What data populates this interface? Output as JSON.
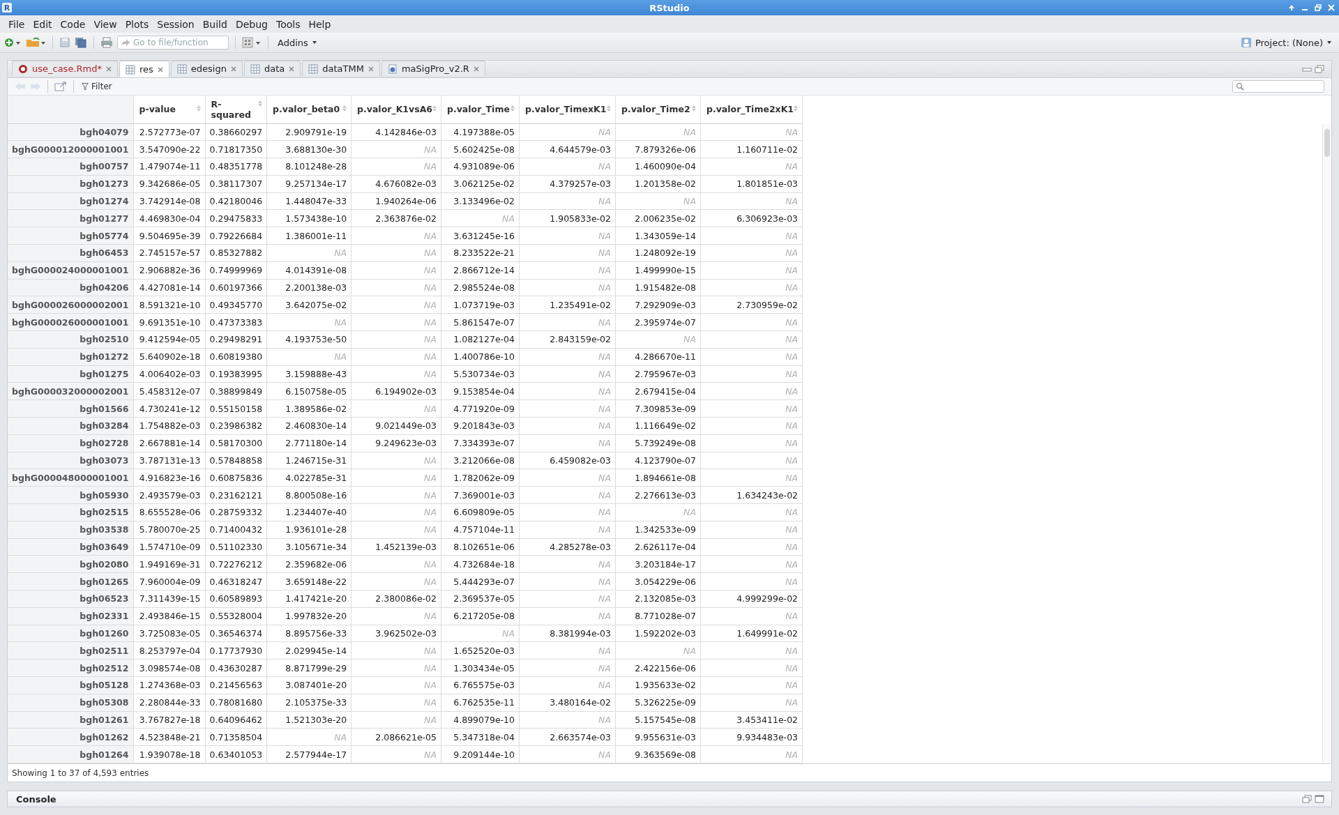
{
  "window": {
    "title": "RStudio",
    "icon_letter": "R"
  },
  "menu": [
    "File",
    "Edit",
    "Code",
    "View",
    "Plots",
    "Session",
    "Build",
    "Debug",
    "Tools",
    "Help"
  ],
  "toolbar": {
    "goto_placeholder": "Go to file/function",
    "addins": "Addins",
    "project": "Project: (None)"
  },
  "tabs": [
    {
      "label": "use_case.Rmd*",
      "kind": "rmd",
      "modified": true,
      "selected": false
    },
    {
      "label": "res",
      "kind": "data",
      "modified": false,
      "selected": true
    },
    {
      "label": "edesign",
      "kind": "data",
      "modified": false,
      "selected": false
    },
    {
      "label": "data",
      "kind": "data",
      "modified": false,
      "selected": false
    },
    {
      "label": "dataTMM",
      "kind": "data",
      "modified": false,
      "selected": false
    },
    {
      "label": "maSigPro_v2.R",
      "kind": "script",
      "modified": false,
      "selected": false
    }
  ],
  "viewer": {
    "filter": "Filter"
  },
  "table": {
    "columns": [
      "p-value",
      "R-squared",
      "p.valor_beta0",
      "p.valor_K1vsA6",
      "p.valor_Time",
      "p.valor_TimexK1",
      "p.valor_Time2",
      "p.valor_Time2xK1"
    ],
    "rows": [
      {
        "name": "bgh04079",
        "values": [
          "2.572773e-07",
          "0.38660297",
          "2.909791e-19",
          "4.142846e-03",
          "4.197388e-05",
          "NA",
          "NA",
          "NA"
        ],
        "missing": [
          false,
          false,
          false,
          false,
          false,
          true,
          true,
          true
        ]
      },
      {
        "name": "bghG000012000001001",
        "values": [
          "3.547090e-22",
          "0.71817350",
          "3.688130e-30",
          "NA",
          "5.602425e-08",
          "4.644579e-03",
          "7.879326e-06",
          "1.160711e-02"
        ],
        "missing": [
          false,
          false,
          false,
          true,
          false,
          false,
          false,
          false
        ]
      },
      {
        "name": "bgh00757",
        "values": [
          "1.479074e-11",
          "0.48351778",
          "8.101248e-28",
          "NA",
          "4.931089e-06",
          "NA",
          "1.460090e-04",
          "NA"
        ],
        "missing": [
          false,
          false,
          false,
          true,
          false,
          true,
          false,
          true
        ]
      },
      {
        "name": "bgh01273",
        "values": [
          "9.342686e-05",
          "0.38117307",
          "9.257134e-17",
          "4.676082e-03",
          "3.062125e-02",
          "4.379257e-03",
          "1.201358e-02",
          "1.801851e-03"
        ],
        "missing": [
          false,
          false,
          false,
          false,
          false,
          false,
          false,
          false
        ]
      },
      {
        "name": "bgh01274",
        "values": [
          "3.742914e-08",
          "0.42180046",
          "1.448047e-33",
          "1.940264e-06",
          "3.133496e-02",
          "NA",
          "NA",
          "NA"
        ],
        "missing": [
          false,
          false,
          false,
          false,
          false,
          true,
          true,
          true
        ]
      },
      {
        "name": "bgh01277",
        "values": [
          "4.469830e-04",
          "0.29475833",
          "1.573438e-10",
          "2.363876e-02",
          "NA",
          "1.905833e-02",
          "2.006235e-02",
          "6.306923e-03"
        ],
        "missing": [
          false,
          false,
          false,
          false,
          true,
          false,
          false,
          false
        ]
      },
      {
        "name": "bgh05774",
        "values": [
          "9.504695e-39",
          "0.79226684",
          "1.386001e-11",
          "NA",
          "3.631245e-16",
          "NA",
          "1.343059e-14",
          "NA"
        ],
        "missing": [
          false,
          false,
          false,
          true,
          false,
          true,
          false,
          true
        ]
      },
      {
        "name": "bgh06453",
        "values": [
          "2.745157e-57",
          "0.85327882",
          "NA",
          "NA",
          "8.233522e-21",
          "NA",
          "1.248092e-19",
          "NA"
        ],
        "missing": [
          false,
          false,
          true,
          true,
          false,
          true,
          false,
          true
        ]
      },
      {
        "name": "bghG000024000001001",
        "values": [
          "2.906882e-36",
          "0.74999969",
          "4.014391e-08",
          "NA",
          "2.866712e-14",
          "NA",
          "1.499990e-15",
          "NA"
        ],
        "missing": [
          false,
          false,
          false,
          true,
          false,
          true,
          false,
          true
        ]
      },
      {
        "name": "bgh04206",
        "values": [
          "4.427081e-14",
          "0.60197366",
          "2.200138e-03",
          "NA",
          "2.985524e-08",
          "NA",
          "1.915482e-08",
          "NA"
        ],
        "missing": [
          false,
          false,
          false,
          true,
          false,
          true,
          false,
          true
        ]
      },
      {
        "name": "bghG000026000002001",
        "values": [
          "8.591321e-10",
          "0.49345770",
          "3.642075e-02",
          "NA",
          "1.073719e-03",
          "1.235491e-02",
          "7.292909e-03",
          "2.730959e-02"
        ],
        "missing": [
          false,
          false,
          false,
          true,
          false,
          false,
          false,
          false
        ]
      },
      {
        "name": "bghG000026000001001",
        "values": [
          "9.691351e-10",
          "0.47373383",
          "NA",
          "NA",
          "5.861547e-07",
          "NA",
          "2.395974e-07",
          "NA"
        ],
        "missing": [
          false,
          false,
          true,
          true,
          false,
          true,
          false,
          true
        ]
      },
      {
        "name": "bgh02510",
        "values": [
          "9.412594e-05",
          "0.29498291",
          "4.193753e-50",
          "NA",
          "1.082127e-04",
          "2.843159e-02",
          "NA",
          "NA"
        ],
        "missing": [
          false,
          false,
          false,
          true,
          false,
          false,
          true,
          true
        ]
      },
      {
        "name": "bgh01272",
        "values": [
          "5.640902e-18",
          "0.60819380",
          "NA",
          "NA",
          "1.400786e-10",
          "NA",
          "4.286670e-11",
          "NA"
        ],
        "missing": [
          false,
          false,
          true,
          true,
          false,
          true,
          false,
          true
        ]
      },
      {
        "name": "bgh01275",
        "values": [
          "4.006402e-03",
          "0.19383995",
          "3.159888e-43",
          "NA",
          "5.530734e-03",
          "NA",
          "2.795967e-03",
          "NA"
        ],
        "missing": [
          false,
          false,
          false,
          true,
          false,
          true,
          false,
          true
        ]
      },
      {
        "name": "bghG000032000002001",
        "values": [
          "5.458312e-07",
          "0.38899849",
          "6.150758e-05",
          "6.194902e-03",
          "9.153854e-04",
          "NA",
          "2.679415e-04",
          "NA"
        ],
        "missing": [
          false,
          false,
          false,
          false,
          false,
          true,
          false,
          true
        ]
      },
      {
        "name": "bgh01566",
        "values": [
          "4.730241e-12",
          "0.55150158",
          "1.389586e-02",
          "NA",
          "4.771920e-09",
          "NA",
          "7.309853e-09",
          "NA"
        ],
        "missing": [
          false,
          false,
          false,
          true,
          false,
          true,
          false,
          true
        ]
      },
      {
        "name": "bgh03284",
        "values": [
          "1.754882e-03",
          "0.23986382",
          "2.460830e-14",
          "9.021449e-03",
          "9.201843e-03",
          "NA",
          "1.116649e-02",
          "NA"
        ],
        "missing": [
          false,
          false,
          false,
          false,
          false,
          true,
          false,
          true
        ]
      },
      {
        "name": "bgh02728",
        "values": [
          "2.667881e-14",
          "0.58170300",
          "2.771180e-14",
          "9.249623e-03",
          "7.334393e-07",
          "NA",
          "5.739249e-08",
          "NA"
        ],
        "missing": [
          false,
          false,
          false,
          false,
          false,
          true,
          false,
          true
        ]
      },
      {
        "name": "bgh03073",
        "values": [
          "3.787131e-13",
          "0.57848858",
          "1.246715e-31",
          "NA",
          "3.212066e-08",
          "6.459082e-03",
          "4.123790e-07",
          "NA"
        ],
        "missing": [
          false,
          false,
          false,
          true,
          false,
          false,
          false,
          true
        ]
      },
      {
        "name": "bghG000048000001001",
        "values": [
          "4.916823e-16",
          "0.60875836",
          "4.022785e-31",
          "NA",
          "1.782062e-09",
          "NA",
          "1.894661e-08",
          "NA"
        ],
        "missing": [
          false,
          false,
          false,
          true,
          false,
          true,
          false,
          true
        ]
      },
      {
        "name": "bgh05930",
        "values": [
          "2.493579e-03",
          "0.23162121",
          "8.800508e-16",
          "NA",
          "7.369001e-03",
          "NA",
          "2.276613e-03",
          "1.634243e-02"
        ],
        "missing": [
          false,
          false,
          false,
          true,
          false,
          true,
          false,
          false
        ]
      },
      {
        "name": "bgh02515",
        "values": [
          "8.655528e-06",
          "0.28759332",
          "1.234407e-40",
          "NA",
          "6.609809e-05",
          "NA",
          "NA",
          "NA"
        ],
        "missing": [
          false,
          false,
          false,
          true,
          false,
          true,
          true,
          true
        ]
      },
      {
        "name": "bgh03538",
        "values": [
          "5.780070e-25",
          "0.71400432",
          "1.936101e-28",
          "NA",
          "4.757104e-11",
          "NA",
          "1.342533e-09",
          "NA"
        ],
        "missing": [
          false,
          false,
          false,
          true,
          false,
          true,
          false,
          true
        ]
      },
      {
        "name": "bgh03649",
        "values": [
          "1.574710e-09",
          "0.51102330",
          "3.105671e-34",
          "1.452139e-03",
          "8.102651e-06",
          "4.285278e-03",
          "2.626117e-04",
          "NA"
        ],
        "missing": [
          false,
          false,
          false,
          false,
          false,
          false,
          false,
          true
        ]
      },
      {
        "name": "bgh02080",
        "values": [
          "1.949169e-31",
          "0.72276212",
          "2.359682e-06",
          "NA",
          "4.732684e-18",
          "NA",
          "3.203184e-17",
          "NA"
        ],
        "missing": [
          false,
          false,
          false,
          true,
          false,
          true,
          false,
          true
        ]
      },
      {
        "name": "bgh01265",
        "values": [
          "7.960004e-09",
          "0.46318247",
          "3.659148e-22",
          "NA",
          "5.444293e-07",
          "NA",
          "3.054229e-06",
          "NA"
        ],
        "missing": [
          false,
          false,
          false,
          true,
          false,
          true,
          false,
          true
        ]
      },
      {
        "name": "bgh06523",
        "values": [
          "7.311439e-15",
          "0.60589893",
          "1.417421e-20",
          "2.380086e-02",
          "2.369537e-05",
          "NA",
          "2.132085e-03",
          "4.999299e-02"
        ],
        "missing": [
          false,
          false,
          false,
          false,
          false,
          true,
          false,
          false
        ]
      },
      {
        "name": "bgh02331",
        "values": [
          "2.493846e-15",
          "0.55328004",
          "1.997832e-20",
          "NA",
          "6.217205e-08",
          "NA",
          "8.771028e-07",
          "NA"
        ],
        "missing": [
          false,
          false,
          false,
          true,
          false,
          true,
          false,
          true
        ]
      },
      {
        "name": "bgh01260",
        "values": [
          "3.725083e-05",
          "0.36546374",
          "8.895756e-33",
          "3.962502e-03",
          "NA",
          "8.381994e-03",
          "1.592202e-03",
          "1.649991e-02"
        ],
        "missing": [
          false,
          false,
          false,
          false,
          true,
          false,
          false,
          false
        ]
      },
      {
        "name": "bgh02511",
        "values": [
          "8.253797e-04",
          "0.17737930",
          "2.029945e-14",
          "NA",
          "1.652520e-03",
          "NA",
          "NA",
          "NA"
        ],
        "missing": [
          false,
          false,
          false,
          true,
          false,
          true,
          true,
          true
        ]
      },
      {
        "name": "bgh02512",
        "values": [
          "3.098574e-08",
          "0.43630287",
          "8.871799e-29",
          "NA",
          "1.303434e-05",
          "NA",
          "2.422156e-06",
          "NA"
        ],
        "missing": [
          false,
          false,
          false,
          true,
          false,
          true,
          false,
          true
        ]
      },
      {
        "name": "bgh05128",
        "values": [
          "1.274368e-03",
          "0.21456563",
          "3.087401e-20",
          "NA",
          "6.765575e-03",
          "NA",
          "1.935633e-02",
          "NA"
        ],
        "missing": [
          false,
          false,
          false,
          true,
          false,
          true,
          false,
          true
        ]
      },
      {
        "name": "bgh05308",
        "values": [
          "2.280844e-33",
          "0.78081680",
          "2.105375e-33",
          "NA",
          "6.762535e-11",
          "3.480164e-02",
          "5.326225e-09",
          "NA"
        ],
        "missing": [
          false,
          false,
          false,
          true,
          false,
          false,
          false,
          true
        ]
      },
      {
        "name": "bgh01261",
        "values": [
          "3.767827e-18",
          "0.64096462",
          "1.521303e-20",
          "NA",
          "4.899079e-10",
          "NA",
          "5.157545e-08",
          "3.453411e-02"
        ],
        "missing": [
          false,
          false,
          false,
          true,
          false,
          true,
          false,
          false
        ]
      },
      {
        "name": "bgh01262",
        "values": [
          "4.523848e-21",
          "0.71358504",
          "NA",
          "2.086621e-05",
          "5.347318e-04",
          "2.663574e-03",
          "9.955631e-03",
          "9.934483e-03"
        ],
        "missing": [
          false,
          false,
          true,
          false,
          false,
          false,
          false,
          false
        ]
      },
      {
        "name": "bgh01264",
        "values": [
          "1.939078e-18",
          "0.63401053",
          "2.577944e-17",
          "NA",
          "9.209144e-10",
          "NA",
          "9.363569e-08",
          "NA"
        ],
        "missing": [
          false,
          false,
          false,
          true,
          false,
          true,
          false,
          true
        ]
      }
    ]
  },
  "status": "Showing 1 to 37 of 4,593 entries",
  "console": {
    "title": "Console"
  }
}
